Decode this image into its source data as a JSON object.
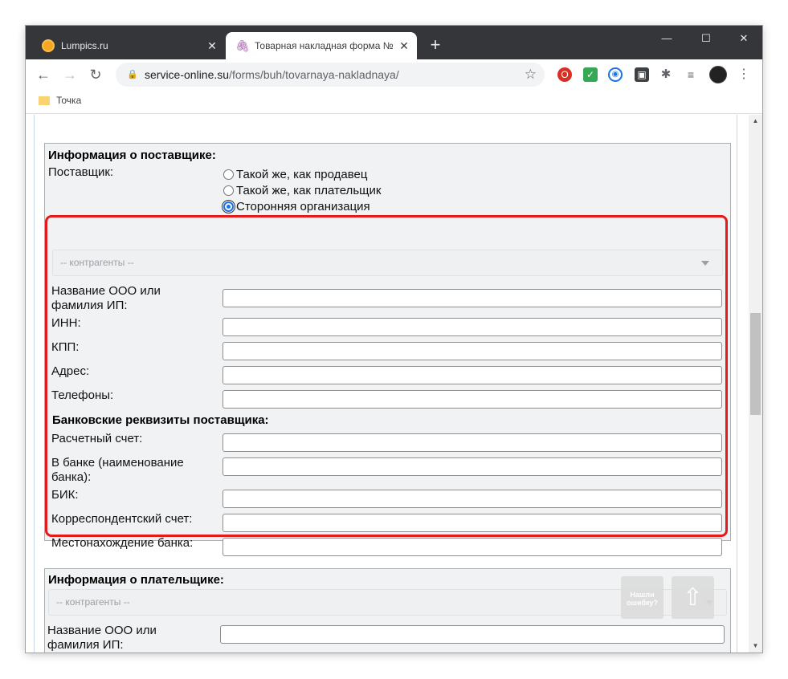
{
  "browser": {
    "tabs": [
      {
        "title": "Lumpics.ru",
        "active": false
      },
      {
        "title": "Товарная накладная форма №",
        "active": true
      }
    ],
    "new_tab": "+",
    "url_host": "service-online.su",
    "url_path": "/forms/buh/tovarnaya-nakladnaya/",
    "bookmark": "Точка",
    "window_controls": {
      "minimize": "—",
      "maximize": "☐",
      "close": "✕"
    }
  },
  "supplier": {
    "legend": "Информация о поставщике:",
    "supplier_label": "Поставщик:",
    "radio_options": [
      {
        "label": "Такой же, как продавец",
        "checked": false
      },
      {
        "label": "Такой же, как плательщик",
        "checked": false
      },
      {
        "label": "Сторонняя организация",
        "checked": true
      }
    ],
    "contractor_placeholder": "-- контрагенты --",
    "fields": {
      "name": "Название ООО или фамилия ИП:",
      "inn": "ИНН:",
      "kpp": "КПП:",
      "address": "Адрес:",
      "phones": "Телефоны:"
    },
    "bank_legend": "Банковские реквизиты поставщика:",
    "bank_fields": {
      "account": "Расчетный счет:",
      "bank_name": "В банке (наименование банка):",
      "bik": "БИК:",
      "corr_account": "Корреспондентский счет:",
      "bank_location": "Местонахождение банка:"
    }
  },
  "payer": {
    "legend": "Информация о плательщике:",
    "contractor_placeholder": "-- контрагенты --",
    "name_label": "Название ООО или фамилия ИП:"
  },
  "floating": {
    "error_button": "Нашли ошибку?",
    "up_button": "⇧"
  },
  "colors": {
    "highlight": "#e51a1a",
    "radio_accent": "#1a73e8",
    "tabbar": "#35363a"
  }
}
